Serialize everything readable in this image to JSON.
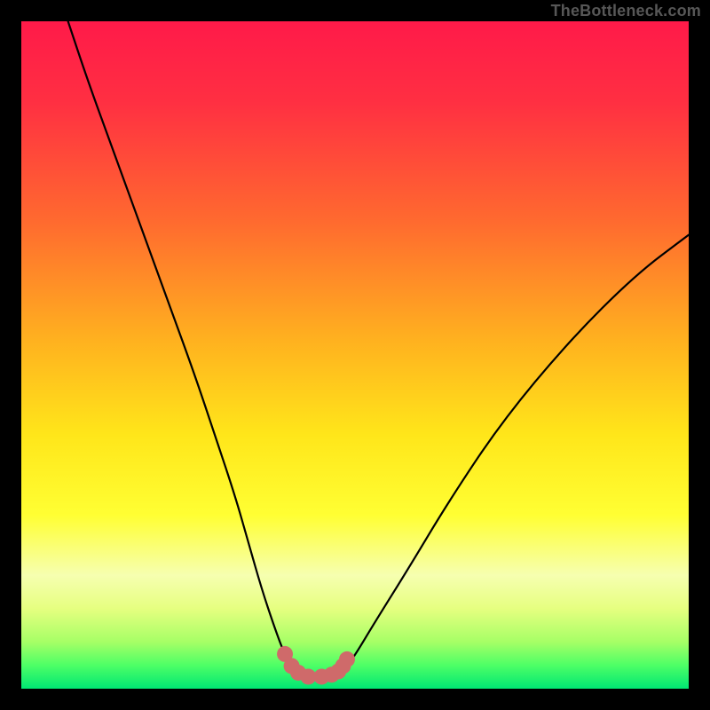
{
  "watermark": "TheBottleneck.com",
  "colors": {
    "black": "#000000",
    "curve": "#000000",
    "marker": "#cf6a6a",
    "gradient_stops": [
      {
        "offset": 0.0,
        "color": "#ff1a49"
      },
      {
        "offset": 0.12,
        "color": "#ff2f42"
      },
      {
        "offset": 0.3,
        "color": "#ff6a2f"
      },
      {
        "offset": 0.48,
        "color": "#ffb21f"
      },
      {
        "offset": 0.62,
        "color": "#ffe61a"
      },
      {
        "offset": 0.74,
        "color": "#ffff33"
      },
      {
        "offset": 0.83,
        "color": "#f6ffb0"
      },
      {
        "offset": 0.88,
        "color": "#e6ff80"
      },
      {
        "offset": 0.93,
        "color": "#a6ff66"
      },
      {
        "offset": 0.965,
        "color": "#4dff66"
      },
      {
        "offset": 1.0,
        "color": "#00e673"
      }
    ]
  },
  "chart_data": {
    "type": "line",
    "title": "",
    "xlabel": "",
    "ylabel": "",
    "xlim": [
      0,
      100
    ],
    "ylim": [
      0,
      100
    ],
    "series": [
      {
        "name": "bottleneck-curve",
        "x": [
          7,
          10,
          14,
          18,
          22,
          26,
          29,
          32,
          34,
          36,
          38,
          39.5,
          41,
          43,
          45,
          47,
          48.5,
          50,
          53,
          58,
          64,
          72,
          82,
          92,
          100
        ],
        "y": [
          100,
          91,
          80,
          69,
          58,
          47,
          38,
          29,
          22,
          15,
          9,
          5,
          2.5,
          1.8,
          1.8,
          2.2,
          3,
          5,
          10,
          18,
          28,
          40,
          52,
          62,
          68
        ]
      }
    ],
    "markers": {
      "name": "highlight-dots",
      "x": [
        39.5,
        40.5,
        41.5,
        43,
        45,
        46.5,
        47.5,
        48.2,
        48.8
      ],
      "y": [
        5.2,
        3.4,
        2.4,
        1.8,
        1.8,
        2.1,
        2.6,
        3.4,
        4.4
      ]
    }
  }
}
